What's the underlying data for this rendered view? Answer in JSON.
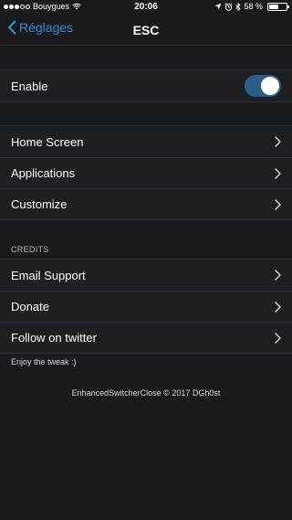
{
  "status_bar": {
    "carrier": "Bouygues",
    "time": "20:06",
    "battery_text": "58 %",
    "battery_level": 0.58
  },
  "nav": {
    "back_label": "Réglages",
    "title": "ESC"
  },
  "enable_row": {
    "label": "Enable",
    "toggle_on": true
  },
  "settings": {
    "items": [
      {
        "label": "Home Screen"
      },
      {
        "label": "Applications"
      },
      {
        "label": "Customize"
      }
    ]
  },
  "credits": {
    "header": "CREDITS",
    "items": [
      {
        "label": "Email Support"
      },
      {
        "label": "Donate"
      },
      {
        "label": "Follow on twitter"
      }
    ],
    "footer": "Enjoy the tweak :)"
  },
  "copyright": "EnhancedSwitcherClose © 2017 DGh0st",
  "colors": {
    "accent": "#2f8ed8",
    "toggle_track": "#2a5f87",
    "background": "#1a1a1c",
    "cell": "#1f1f21",
    "separator": "#1f3445"
  }
}
